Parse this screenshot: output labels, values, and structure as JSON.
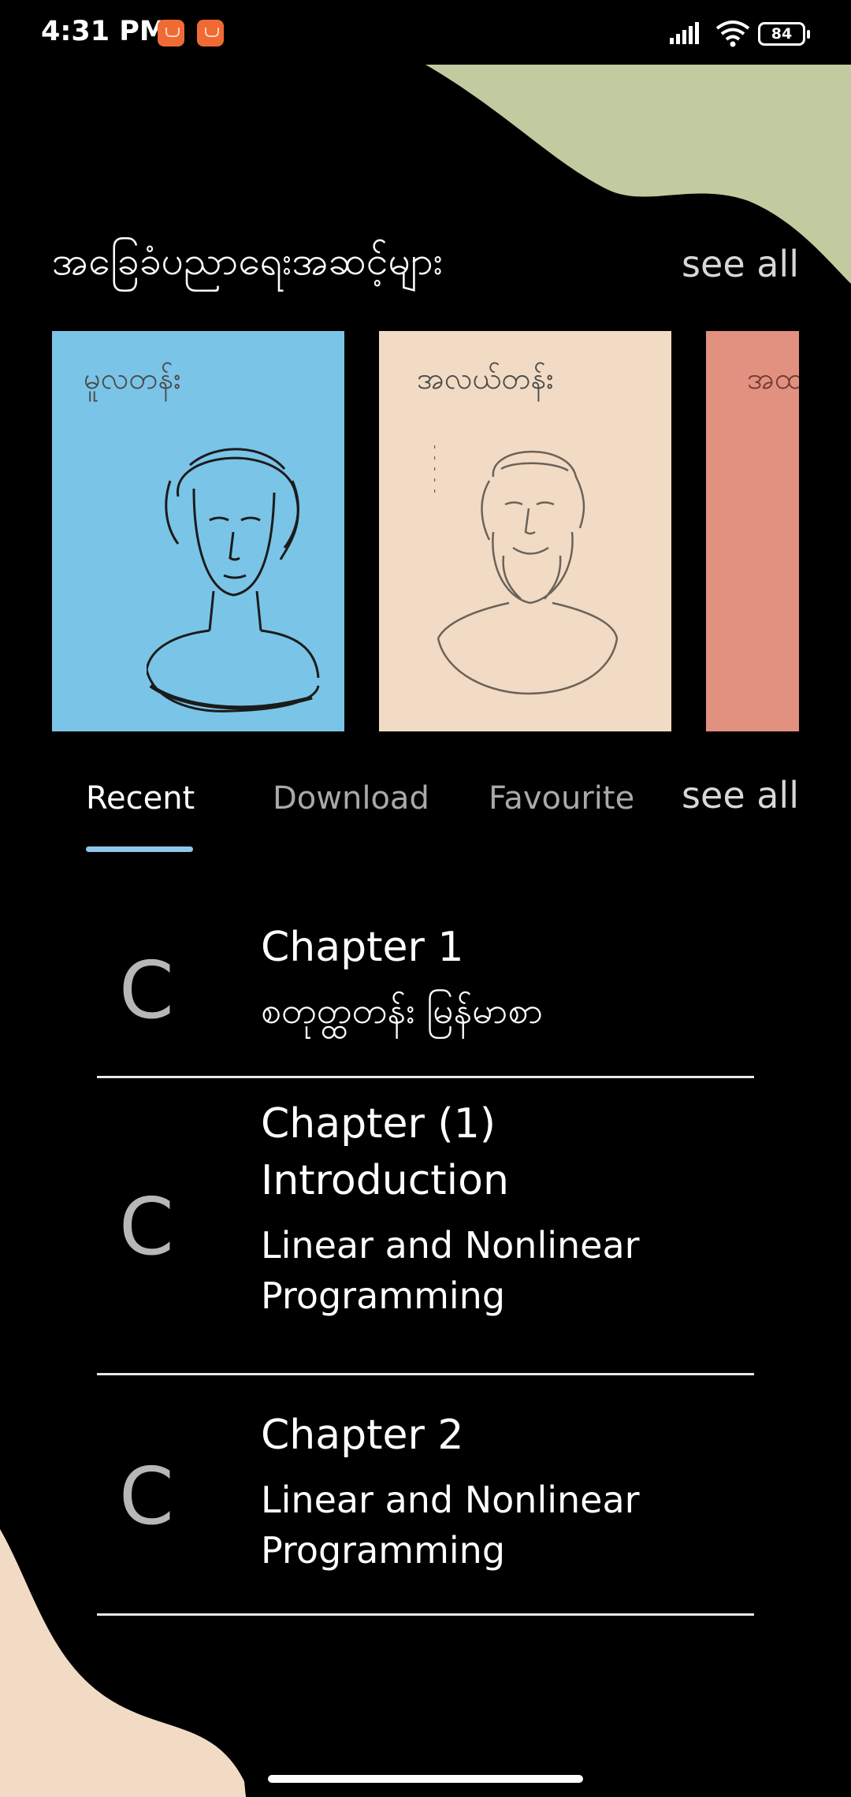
{
  "status_bar": {
    "time": "4:31 PM",
    "battery": "84",
    "icons": [
      "notification-icon",
      "notification-icon",
      "signal-icon",
      "wifi-icon",
      "battery-icon"
    ]
  },
  "colors": {
    "background": "#000000",
    "blob_green": "#c1cb9f",
    "blob_peach": "#f1dbc4",
    "card_blue": "#7ac4e8",
    "card_peach": "#f1dbc4",
    "card_salmon": "#e2907f",
    "tab_indicator": "#8ec9ec"
  },
  "section": {
    "title": "အခြေခံပညာရေးအဆင့်များ",
    "see_all": "see all"
  },
  "cards": [
    {
      "title": "မူလတန်း",
      "image": "female-bust-illustration"
    },
    {
      "title": "အလယ်တန်း",
      "image": "bearded-male-bust-illustration"
    },
    {
      "title": "အထ"
    }
  ],
  "tabs": {
    "items": [
      {
        "label": "Recent",
        "active": true
      },
      {
        "label": "Download",
        "active": false
      },
      {
        "label": "Favourite",
        "active": false
      }
    ],
    "see_all": "see all"
  },
  "list": [
    {
      "letter": "C",
      "title": "Chapter 1",
      "subtitle": "စတုတ္ထတန်း မြန်မာစာ"
    },
    {
      "letter": "C",
      "title": "Chapter (1) Introduction",
      "subtitle": "Linear and Nonlinear Programming"
    },
    {
      "letter": "C",
      "title": "Chapter 2",
      "subtitle": "Linear and Nonlinear Programming"
    }
  ]
}
